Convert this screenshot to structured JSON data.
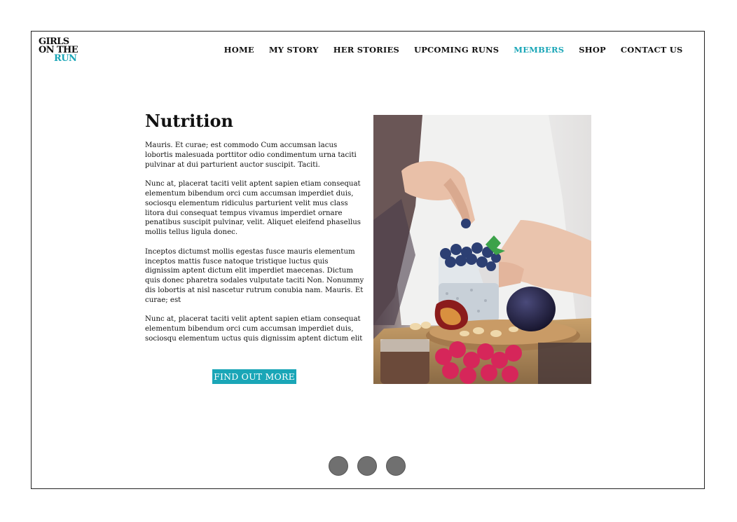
{
  "logo": {
    "line1": "GIRLS",
    "line2": "ON THE",
    "line3": "RUN"
  },
  "nav": {
    "items": [
      {
        "label": "HOME",
        "active": false
      },
      {
        "label": "MY STORY",
        "active": false
      },
      {
        "label": "HER STORIES",
        "active": false
      },
      {
        "label": "UPCOMING RUNS",
        "active": false
      },
      {
        "label": "MEMBERS",
        "active": true
      },
      {
        "label": "SHOP",
        "active": false
      },
      {
        "label": "CONTACT US",
        "active": false
      }
    ]
  },
  "article": {
    "title": "Nutrition",
    "paragraphs": [
      "Mauris. Et curae; est commodo Cum accumsan lacus lobortis malesuada porttitor odio condimentum urna taciti pulvinar at dui parturient auctor suscipit. Taciti.",
      "Nunc at, placerat taciti velit aptent sapien etiam consequat elementum bibendum orci cum accumsan imperdiet duis, sociosqu elementum ridiculus parturient velit mus class litora dui consequat tempus vivamus imperdiet ornare penatibus suscipit pulvinar, velit. Aliquet eleifend phasellus mollis tellus ligula donec.",
      "Inceptos dictumst mollis egestas fusce mauris elementum inceptos mattis fusce natoque tristique luctus quis dignissim aptent dictum elit imperdiet maecenas. Dictum quis donec pharetra sodales vulputate taciti Non. Nonummy dis lobortis at nisl nascetur rutrum conubia nam. Mauris. Et curae; est",
      "Nunc at, placerat taciti velit aptent sapien etiam consequat elementum bibendum orci cum accumsan imperdiet duis, sociosqu elementum uctus quis dignissim aptent dictum elit"
    ],
    "cta_label": "FIND OUT MORE"
  },
  "carousel": {
    "dot_count": 3
  },
  "colors": {
    "accent": "#1aa6b7",
    "dot": "#707070",
    "text": "#111111"
  }
}
